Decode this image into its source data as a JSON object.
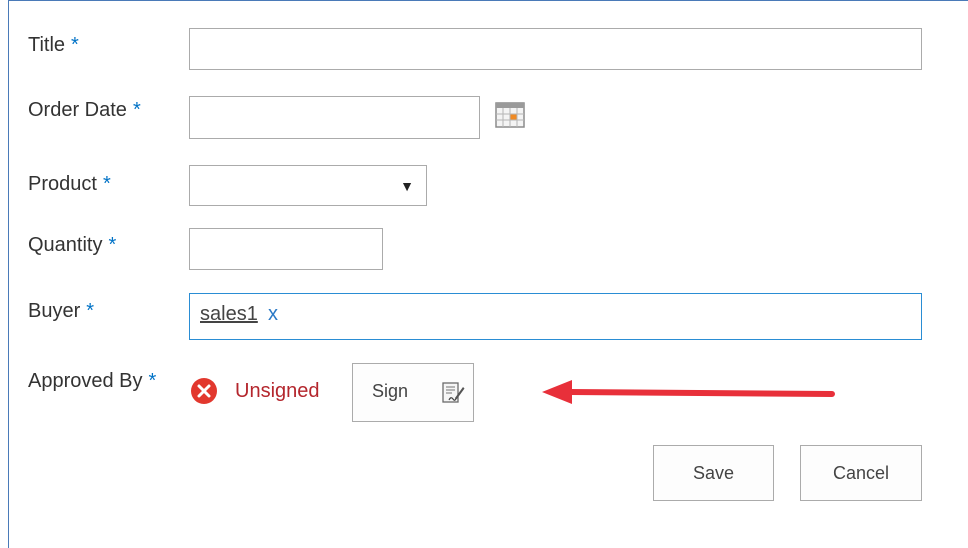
{
  "form": {
    "title_label": "Title",
    "order_date_label": "Order Date",
    "product_label": "Product",
    "quantity_label": "Quantity",
    "buyer_label": "Buyer",
    "approved_by_label": "Approved By",
    "required_marker": "*",
    "title_value": "",
    "order_date_value": "",
    "product_value": "",
    "quantity_value": "",
    "buyer_value": "sales1",
    "buyer_remove": "x",
    "approval_status": "Unsigned",
    "sign_label": "Sign",
    "save_label": "Save",
    "cancel_label": "Cancel"
  },
  "icons": {
    "calendar": "calendar-icon",
    "dropdown": "triangle-down",
    "status": "error-circle-x-icon",
    "sign": "document-pen-icon"
  },
  "colors": {
    "required": "#0072c6",
    "unsigned": "#b4262d",
    "annotation_arrow": "#e8303a",
    "focus_border": "#2a8dd4"
  }
}
